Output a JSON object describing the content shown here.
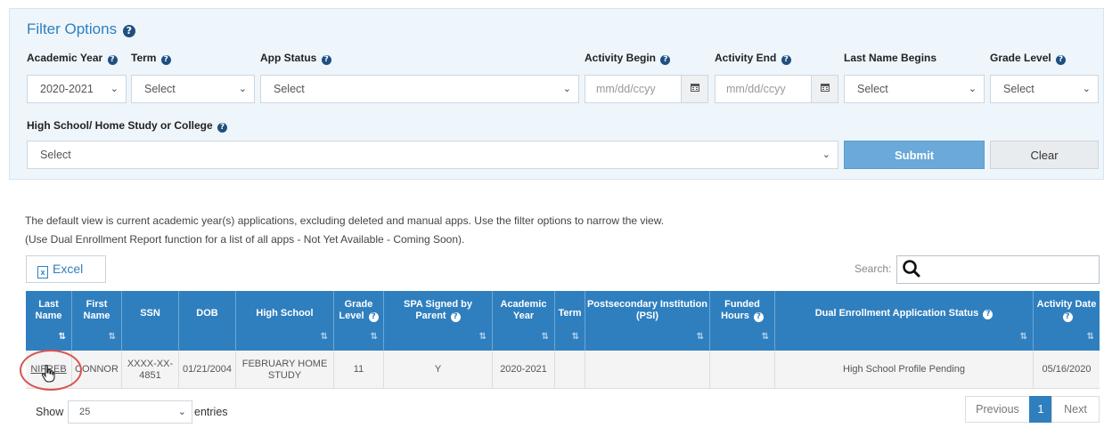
{
  "filter": {
    "title": "Filter Options",
    "labels": {
      "academic_year": "Academic Year",
      "term": "Term",
      "app_status": "App Status",
      "activity_begin": "Activity Begin",
      "activity_end": "Activity End",
      "last_name_begins": "Last Name Begins",
      "grade_level": "Grade Level",
      "high_school": "High School/ Home Study or College"
    },
    "values": {
      "academic_year": "2020-2021",
      "term": "Select",
      "app_status": "Select",
      "activity_begin_placeholder": "mm/dd/ccyy",
      "activity_end_placeholder": "mm/dd/ccyy",
      "last_name_begins": "Select",
      "grade_level": "Select",
      "high_school": "Select"
    },
    "submit": "Submit",
    "clear": "Clear"
  },
  "info": {
    "line1": "The default view is current academic year(s) applications, excluding deleted and manual apps. Use the filter options to narrow the view.",
    "line2": "(Use Dual Enrollment Report function for a list of all apps - Not Yet Available - Coming Soon)."
  },
  "toolbar": {
    "excel": "Excel",
    "search_label": "Search:"
  },
  "table": {
    "headers": {
      "last_name": [
        "Last",
        "Name"
      ],
      "first_name": [
        "First",
        "Name"
      ],
      "ssn": "SSN",
      "dob": "DOB",
      "high_school": "High School",
      "grade_level": [
        "Grade",
        "Level"
      ],
      "spa_signed": "SPA Signed by Parent",
      "academic_year": [
        "Academic",
        "Year"
      ],
      "term": "Term",
      "psi": [
        "Postsecondary Institution",
        "(PSI)"
      ],
      "funded_hours": [
        "Funded",
        "Hours"
      ],
      "status": "Dual Enrollment Application Status",
      "activity_date": "Activity Date"
    },
    "rows": [
      {
        "last_name": "NIFREB",
        "first_name": "CONNOR",
        "ssn": [
          "XXXX-XX-",
          "4851"
        ],
        "dob": "01/21/2004",
        "high_school": [
          "FEBRUARY HOME",
          "STUDY"
        ],
        "grade_level": "11",
        "spa_signed": "Y",
        "academic_year": "2020-2021",
        "term": "",
        "psi": "",
        "funded_hours": "",
        "status": "High School Profile Pending",
        "activity_date": "05/16/2020"
      }
    ]
  },
  "footer": {
    "show": "Show",
    "page_size": "25",
    "entries": "entries",
    "previous": "Previous",
    "current_page": "1",
    "next": "Next"
  },
  "colors": {
    "accent": "#2f7fbf",
    "panel_bg": "#eef6fb",
    "submit_bg": "#6aa9d9",
    "highlight_circle": "#d9534f"
  }
}
